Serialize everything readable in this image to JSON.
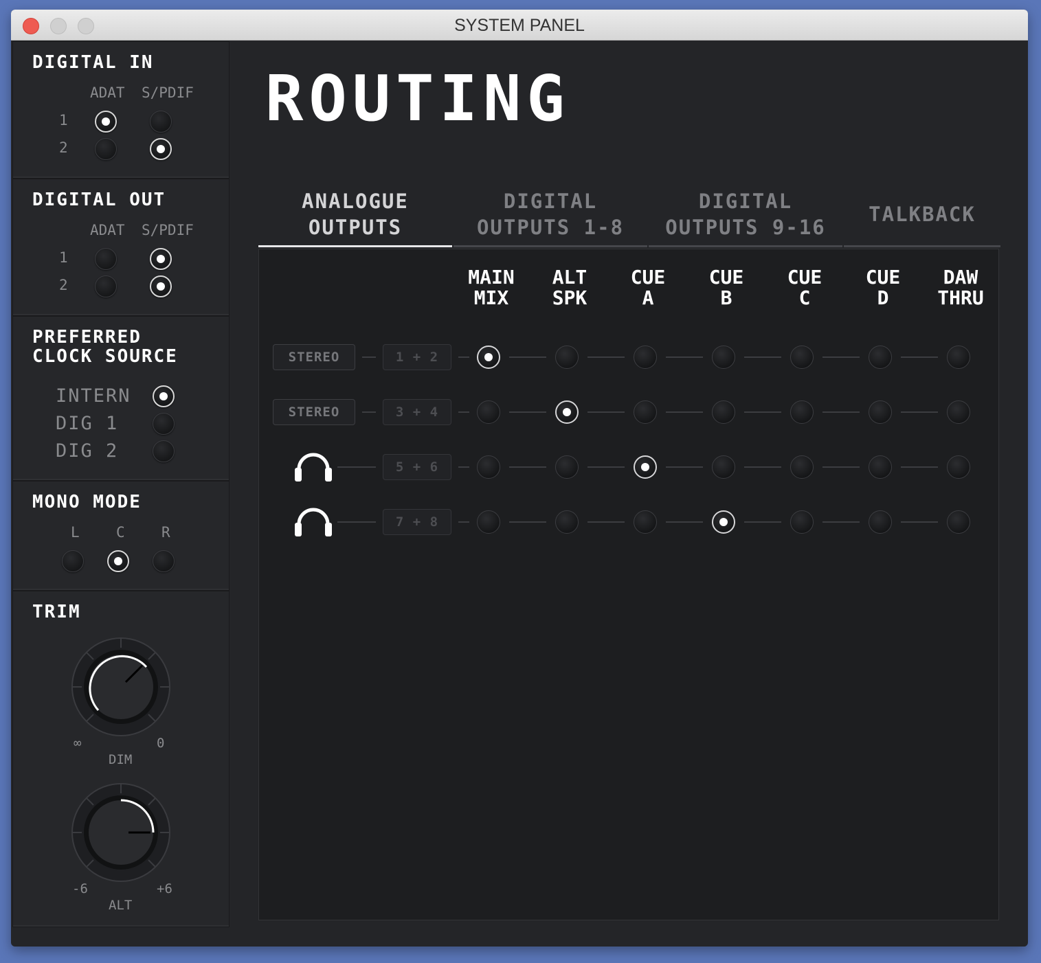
{
  "window": {
    "title": "SYSTEM PANEL"
  },
  "digital_in": {
    "title": "DIGITAL IN",
    "col_labels": [
      "ADAT",
      "S/PDIF"
    ],
    "row_labels": [
      "1",
      "2"
    ],
    "selected": {
      "1": "ADAT",
      "2": "S/PDIF"
    }
  },
  "digital_out": {
    "title": "DIGITAL OUT",
    "col_labels": [
      "ADAT",
      "S/PDIF"
    ],
    "row_labels": [
      "1",
      "2"
    ],
    "selected": {
      "1": "S/PDIF",
      "2": "S/PDIF"
    }
  },
  "clock": {
    "title": "PREFERRED\nCLOCK SOURCE",
    "options": [
      "INTERN",
      "DIG 1",
      "DIG 2"
    ],
    "selected": "INTERN"
  },
  "mono": {
    "title": "MONO MODE",
    "options": [
      "L",
      "C",
      "R"
    ],
    "selected": "C"
  },
  "trim": {
    "title": "TRIM",
    "dim": {
      "label": "DIM",
      "min_label": "∞",
      "max_label": "0"
    },
    "alt": {
      "label": "ALT",
      "min_label": "-6",
      "max_label": "+6"
    }
  },
  "routing": {
    "heading": "ROUTING",
    "tabs": [
      {
        "label": "ANALOGUE\nOUTPUTS",
        "active": true
      },
      {
        "label": "DIGITAL\nOUTPUTS 1-8",
        "active": false
      },
      {
        "label": "DIGITAL\nOUTPUTS 9-16",
        "active": false
      },
      {
        "label": "TALKBACK",
        "active": false
      }
    ],
    "columns": [
      "MAIN\nMIX",
      "ALT\nSPK",
      "CUE\nA",
      "CUE\nB",
      "CUE\nC",
      "CUE\nD",
      "DAW\nTHRU"
    ],
    "rows": [
      {
        "type": "STEREO",
        "channels": "1 + 2",
        "selected": 0
      },
      {
        "type": "STEREO",
        "channels": "3 + 4",
        "selected": 1
      },
      {
        "type": "headphones-icon",
        "channels": "5 + 6",
        "selected": 2
      },
      {
        "type": "headphones-icon",
        "channels": "7 + 8",
        "selected": 3
      }
    ]
  },
  "colors": {
    "accent": "#ffffff",
    "panel": "#26272a",
    "background": "#1d1e20"
  }
}
